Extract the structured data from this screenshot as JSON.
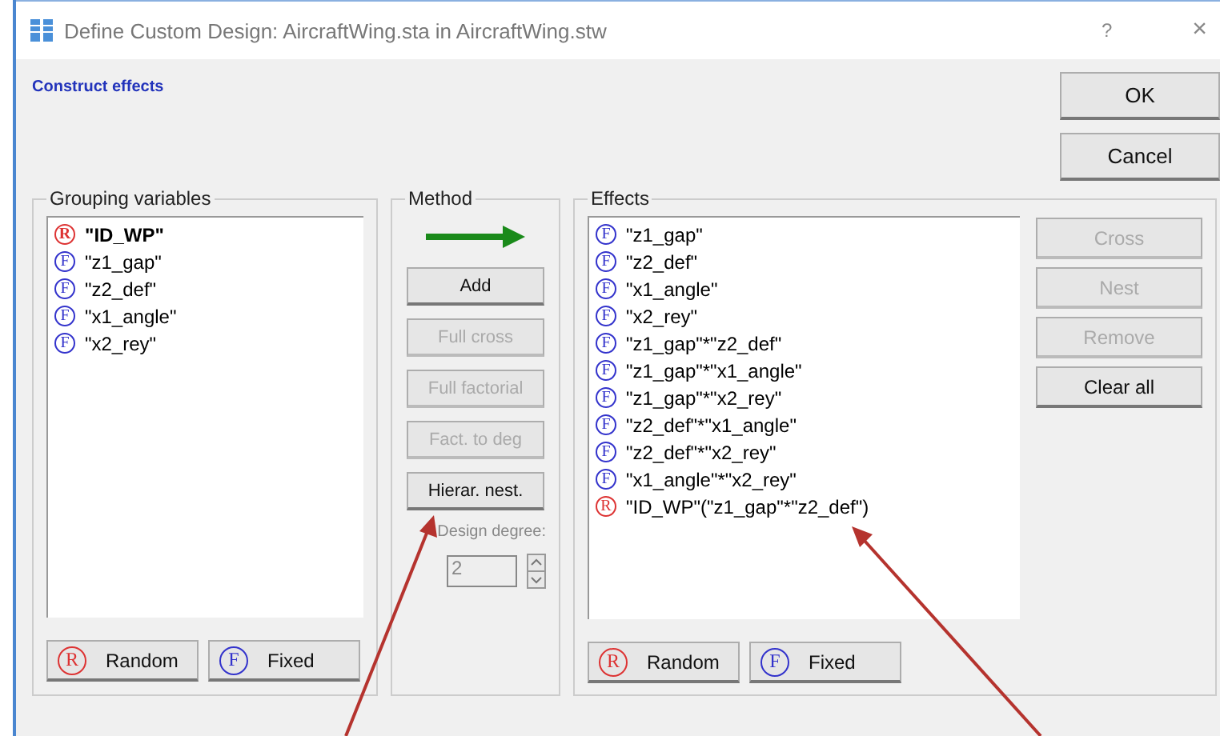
{
  "window": {
    "title": "Define Custom Design: AircraftWing.sta in AircraftWing.stw",
    "help": "?",
    "close": "×"
  },
  "section_link": "Construct effects",
  "dialog_buttons": [
    {
      "label": "OK",
      "disabled": false
    },
    {
      "label": "Cancel",
      "disabled": false
    }
  ],
  "grouping_variables": {
    "title": "Grouping variables",
    "items": [
      {
        "kind": "random",
        "badge": "R",
        "label": "\"ID_WP\"",
        "selected": true
      },
      {
        "kind": "fixed",
        "badge": "F",
        "label": "\"z1_gap\"",
        "selected": false
      },
      {
        "kind": "fixed",
        "badge": "F",
        "label": "\"z2_def\"",
        "selected": false
      },
      {
        "kind": "fixed",
        "badge": "F",
        "label": "\"x1_angle\"",
        "selected": false
      },
      {
        "kind": "fixed",
        "badge": "F",
        "label": "\"x2_rey\"",
        "selected": false
      }
    ],
    "buttons": [
      {
        "kind": "random",
        "badge": "R",
        "label": "Random"
      },
      {
        "kind": "fixed",
        "badge": "F",
        "label": "Fixed"
      }
    ]
  },
  "method": {
    "title": "Method",
    "buttons": [
      {
        "label": "Add",
        "disabled": false
      },
      {
        "label": "Full cross",
        "disabled": true
      },
      {
        "label": "Full factorial",
        "disabled": true
      },
      {
        "label": "Fact. to deg",
        "disabled": true
      },
      {
        "label": "Hierar. nest.",
        "disabled": false
      }
    ],
    "degree_label": "Design degree:",
    "degree_value": "2",
    "degree_disabled": true
  },
  "effects": {
    "title": "Effects",
    "items": [
      {
        "kind": "fixed",
        "badge": "F",
        "label": "\"z1_gap\""
      },
      {
        "kind": "fixed",
        "badge": "F",
        "label": "\"z2_def\""
      },
      {
        "kind": "fixed",
        "badge": "F",
        "label": "\"x1_angle\""
      },
      {
        "kind": "fixed",
        "badge": "F",
        "label": "\"x2_rey\""
      },
      {
        "kind": "fixed",
        "badge": "F",
        "label": "\"z1_gap\"*\"z2_def\""
      },
      {
        "kind": "fixed",
        "badge": "F",
        "label": "\"z1_gap\"*\"x1_angle\""
      },
      {
        "kind": "fixed",
        "badge": "F",
        "label": "\"z1_gap\"*\"x2_rey\""
      },
      {
        "kind": "fixed",
        "badge": "F",
        "label": "\"z2_def\"*\"x1_angle\""
      },
      {
        "kind": "fixed",
        "badge": "F",
        "label": "\"z2_def\"*\"x2_rey\""
      },
      {
        "kind": "fixed",
        "badge": "F",
        "label": "\"x1_angle\"*\"x2_rey\""
      },
      {
        "kind": "random",
        "badge": "R",
        "label": "\"ID_WP\"(\"z1_gap\"*\"z2_def\")"
      }
    ],
    "side_buttons": [
      {
        "label": "Cross",
        "disabled": true
      },
      {
        "label": "Nest",
        "disabled": true
      },
      {
        "label": "Remove",
        "disabled": true
      },
      {
        "label": "Clear all",
        "disabled": false
      }
    ],
    "buttons": [
      {
        "kind": "random",
        "badge": "R",
        "label": "Random"
      },
      {
        "kind": "fixed",
        "badge": "F",
        "label": "Fixed"
      }
    ]
  }
}
